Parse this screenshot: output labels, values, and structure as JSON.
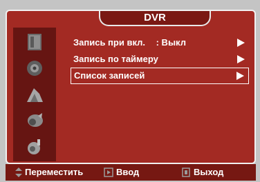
{
  "menu": {
    "title": "DVR",
    "items": [
      {
        "label": "Запись при вкл.",
        "value": ": Выкл"
      },
      {
        "label": "Запись по таймеру",
        "value": ""
      },
      {
        "label": "Список записей",
        "value": ""
      }
    ],
    "selected_index": 2
  },
  "side_icons": [
    "picture-icon",
    "sound-icon",
    "channel-icon",
    "setup-icon",
    "input-icon"
  ],
  "footer": {
    "move_label": "Переместить",
    "enter_label": "Ввод",
    "exit_label": "Выход"
  },
  "colors": {
    "panel": "#a32a23",
    "strip": "#661512",
    "footer": "#761812",
    "text": "#ffffff"
  }
}
